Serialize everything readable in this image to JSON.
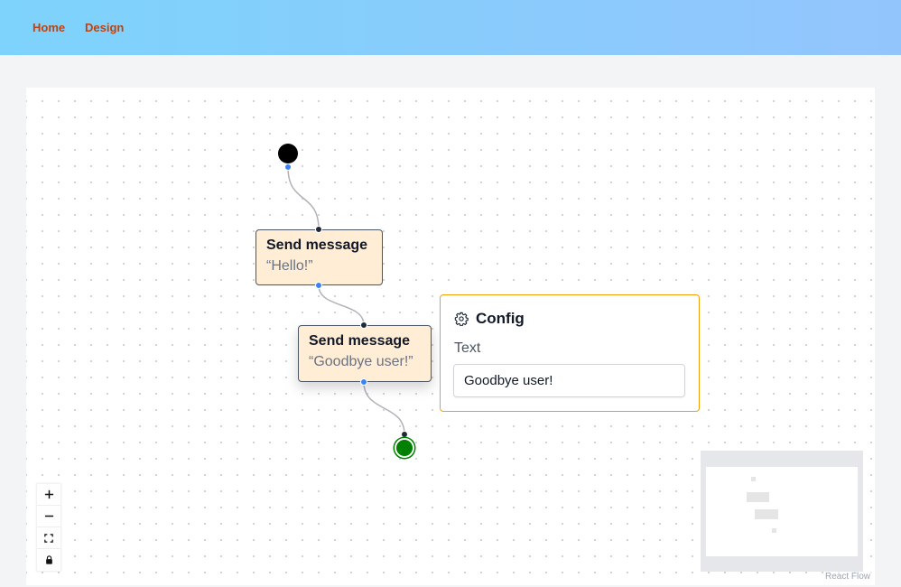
{
  "nav": {
    "home_label": "Home",
    "design_label": "Design"
  },
  "flow": {
    "nodes": [
      {
        "title": "Send message",
        "text": "“Hello!”"
      },
      {
        "title": "Send message",
        "text": "“Goodbye user!”"
      }
    ]
  },
  "config": {
    "title": "Config",
    "field_label": "Text",
    "field_value": "Goodbye user!"
  },
  "controls": {
    "zoom_in_icon": "plus-icon",
    "zoom_out_icon": "minus-icon",
    "fit_view_icon": "fit-view-icon",
    "lock_icon": "lock-icon"
  },
  "attribution": "React Flow",
  "colors": {
    "header_gradient_start": "#7dd3fc",
    "header_gradient_end": "#93c5fd",
    "nav_link": "#c2410c",
    "node_fill": "#ffedd5",
    "config_border": "#f59e0b",
    "end_node": "#008000",
    "start_node": "#000000"
  }
}
